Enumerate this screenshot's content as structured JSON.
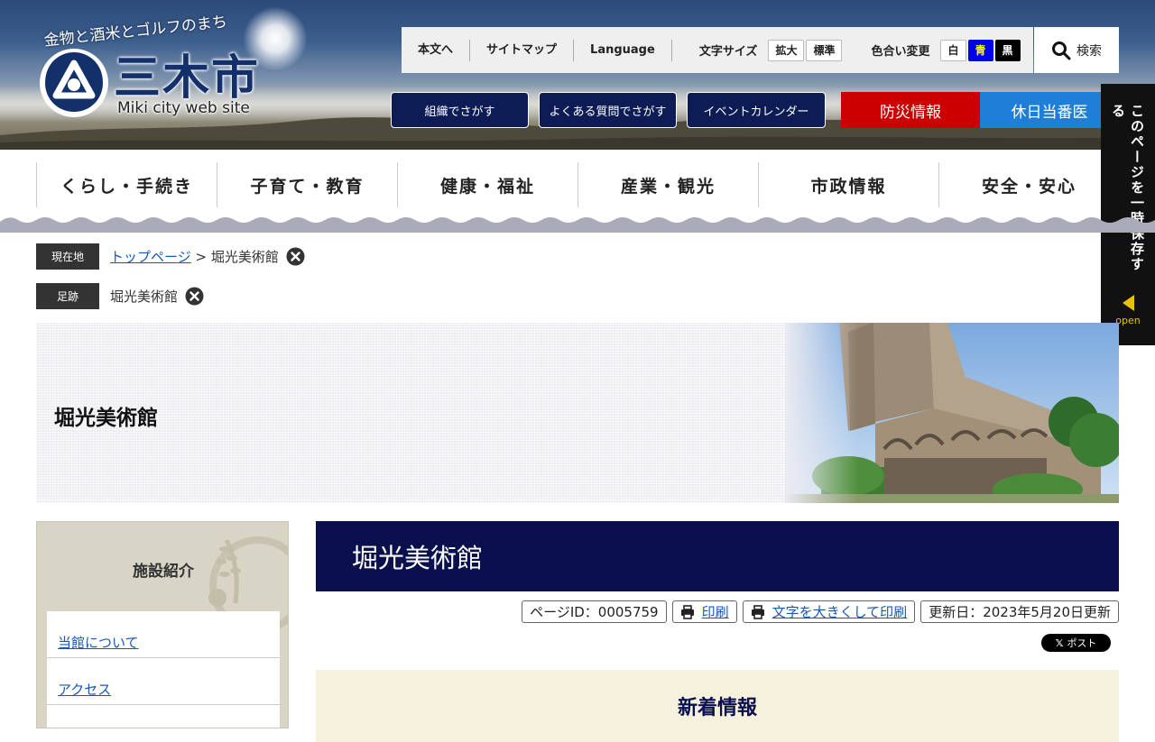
{
  "header": {
    "logo_tagline": "金物と酒米とゴルフのまち",
    "logo_name": "三木市",
    "logo_en": "Miki city web site",
    "utility_links": [
      "本文へ",
      "サイトマップ",
      "Language"
    ],
    "font_size": {
      "label": "文字サイズ",
      "options": [
        "拡大",
        "標準"
      ]
    },
    "color_change": {
      "label": "色合い変更",
      "options": [
        "白",
        "青",
        "黒"
      ]
    },
    "search_label": "検索",
    "quick_nav": [
      "組織でさがす",
      "よくある質問でさがす",
      "イベントカレンダー"
    ],
    "disaster_label": "防災情報",
    "holiday_doctor_label": "休日当番医",
    "colors": {
      "disaster": "#cc0000",
      "holiday": "#1f7fd8",
      "navy": "#0a0f4e"
    }
  },
  "side_tab": {
    "label": "このページを一時保存する",
    "open_label": "open"
  },
  "global_nav": [
    "くらし・手続き",
    "子育て・教育",
    "健康・福祉",
    "産業・観光",
    "市政情報",
    "安全・安心"
  ],
  "breadcrumb": {
    "current_label": "現在地",
    "home_link": "トップページ",
    "separator": " > ",
    "current_page": "堀光美術館",
    "history_label": "足跡",
    "history_item": "堀光美術館"
  },
  "hero": {
    "title": "堀光美術館"
  },
  "sidebar": {
    "title": "施設紹介",
    "items": [
      "当館について",
      "アクセス"
    ]
  },
  "main": {
    "title": "堀光美術館",
    "page_id": "ページID：0005759",
    "print_label": "印刷",
    "large_print_label": "文字を大きくして印刷",
    "updated": "更新日：2023年5月20日更新",
    "x_post_label": "ポスト",
    "news_title": "新着情報"
  }
}
